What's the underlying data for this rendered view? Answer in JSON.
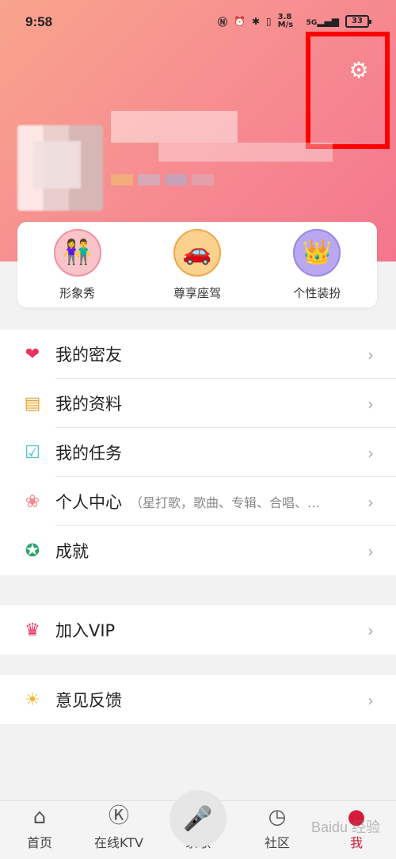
{
  "status": {
    "time": "9:58",
    "network_speed": "3.8 M/s",
    "network_type": "5G",
    "battery": "33"
  },
  "features": [
    {
      "label": "形象秀",
      "icon": "avatar-show-icon"
    },
    {
      "label": "尊享座驾",
      "icon": "car-icon"
    },
    {
      "label": "个性装扮",
      "icon": "crown-icon"
    }
  ],
  "menu_main": [
    {
      "label": "我的密友",
      "icon": "heart-friends-icon",
      "color": "#e8335f"
    },
    {
      "label": "我的资料",
      "icon": "id-card-icon",
      "color": "#f2a22c"
    },
    {
      "label": "我的任务",
      "icon": "task-clipboard-icon",
      "color": "#42c1d4"
    },
    {
      "label": "个人中心",
      "sub": "（星打歌，歌曲、专辑、合唱、…",
      "icon": "lotus-icon",
      "color": "#f38b8f"
    },
    {
      "label": "成就",
      "icon": "medal-icon",
      "color": "#2ba56b"
    }
  ],
  "menu_vip": [
    {
      "label": "加入VIP",
      "icon": "vip-crown-icon",
      "color": "#e8335f"
    }
  ],
  "menu_feedback": [
    {
      "label": "意见反馈",
      "icon": "lightbulb-icon",
      "color": "#f5b52d"
    }
  ],
  "bottom_nav": [
    {
      "label": "首页",
      "icon": "home-icon"
    },
    {
      "label": "在线KTV",
      "icon": "ktv-icon"
    },
    {
      "label": "录歌",
      "icon": "microphone-icon"
    },
    {
      "label": "社区",
      "icon": "clock-icon"
    },
    {
      "label": "我",
      "icon": "me-icon"
    }
  ],
  "watermark": "Baidu 经验"
}
